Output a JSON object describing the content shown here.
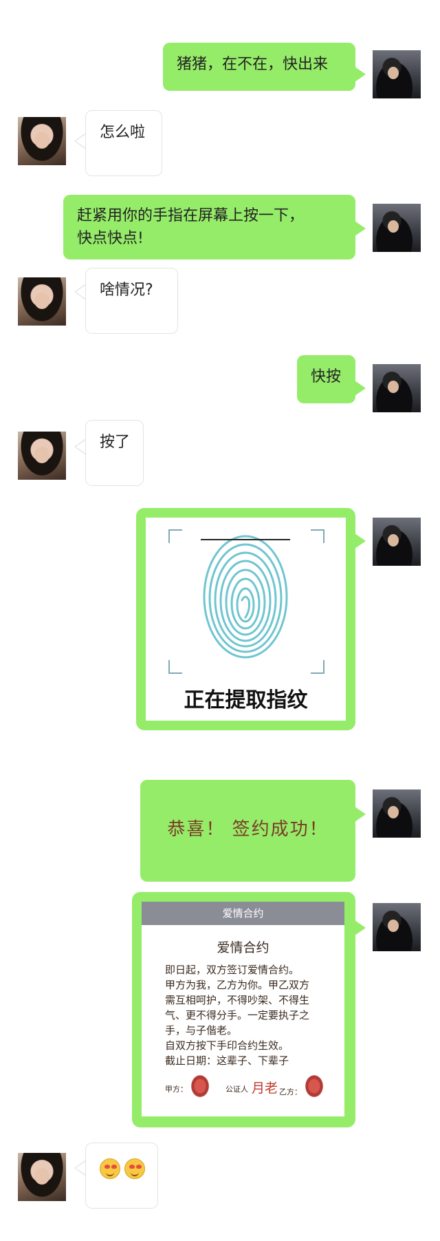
{
  "messages": [
    {
      "from": "me",
      "text": "猪猪，在不在，快出来"
    },
    {
      "from": "her",
      "text": "怎么啦"
    },
    {
      "from": "me",
      "text_line1": "赶紧用你的手指在屏幕上按一下，",
      "text_line2": "快点快点!"
    },
    {
      "from": "her",
      "text": "啥情况?"
    },
    {
      "from": "me",
      "text": "快按"
    },
    {
      "from": "her",
      "text": "按了"
    },
    {
      "from": "me",
      "caption": "正在提取指纹"
    },
    {
      "from": "me",
      "text": "恭喜！ 签约成功！"
    },
    {
      "from": "me",
      "header": "爱情合约",
      "title": "爱情合约",
      "lines": [
        "即日起，双方签订爱情合约。",
        "甲方为我，乙方为你。甲乙双方",
        "需互相呵护，不得吵架、不得生",
        "气、更不得分手。一定要执子之",
        "手，与子偕老。",
        "自双方按下手印合约生效。",
        "截止日期：这辈子、下辈子"
      ],
      "party_a": "甲方：",
      "notary_prefix": "公证人",
      "notary_name": "月老",
      "party_b": "乙方："
    },
    {
      "from": "her",
      "emoji": [
        "heart-eyes-emoji",
        "heart-eyes-emoji"
      ]
    }
  ],
  "colors": {
    "my_bubble": "#95ec69",
    "their_bubble": "#ffffff",
    "fingerprint": "#6fc5cf",
    "notary": "#c0392b"
  }
}
